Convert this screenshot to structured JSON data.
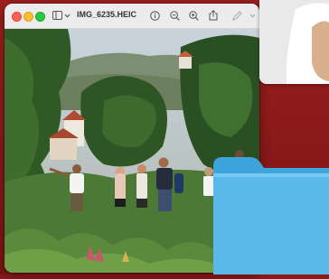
{
  "window": {
    "title": "IMG_6235.HEIC",
    "toolbar": {
      "sidebar_icon": "sidebar-icon",
      "chevron_icon": "chevron-down-icon",
      "info_icon": "info-icon",
      "zoom_out_icon": "zoom-out-icon",
      "zoom_in_icon": "zoom-in-icon",
      "share_icon": "share-icon",
      "markup_icon": "markup-pen-icon",
      "markup_chevron_icon": "chevron-down-icon"
    }
  },
  "colors": {
    "desktop": "#8b1a1a",
    "folder": "#5ab8ea",
    "titlebar": "#ececec"
  }
}
